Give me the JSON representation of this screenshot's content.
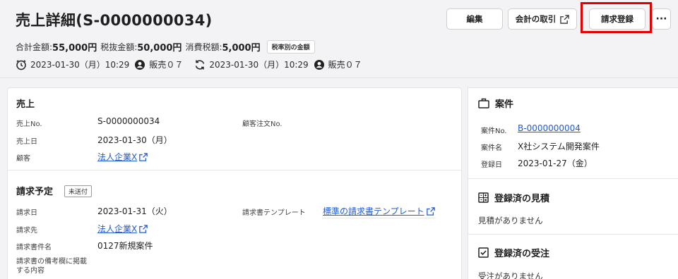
{
  "header": {
    "title": "売上詳細(S-0000000034)",
    "buttons": {
      "edit": "編集",
      "journal": "会計の取引",
      "invoice": "請求登録",
      "more": "···"
    }
  },
  "amounts": {
    "total_label": "合計金額:",
    "total_value": "55,000円",
    "pretax_label": "税抜金額:",
    "pretax_value": "50,000円",
    "tax_label": "消費税額:",
    "tax_value": "5,000円",
    "tax_badge": "税率別の金額"
  },
  "meta": {
    "created_at": "2023-01-30（月）10:29",
    "created_by": "販売０７",
    "updated_at": "2023-01-30（月）10:29",
    "updated_by": "販売０７"
  },
  "sales": {
    "section_title": "売上",
    "no_label": "売上No.",
    "no_value": "S-0000000034",
    "customer_order_label": "顧客注文No.",
    "date_label": "売上日",
    "date_value": "2023-01-30（月）",
    "customer_label": "顧客",
    "customer_value": "法人企業X"
  },
  "billing": {
    "section_title": "請求予定",
    "status": "未送付",
    "date_label": "請求日",
    "date_value": "2023-01-31（火）",
    "template_label": "請求書テンプレート",
    "template_value": "標準の請求書テンプレート",
    "to_label": "請求先",
    "to_value": "法人企業X",
    "subject_label": "請求書件名",
    "subject_value": "0127新規案件",
    "remarks_label_1": "請求書の備考欄に掲載",
    "remarks_label_2": "する内容"
  },
  "side": {
    "project": {
      "title": "案件",
      "no_label": "案件No.",
      "no_value": "B-0000000004",
      "name_label": "案件名",
      "name_value": "X社システム開発案件",
      "date_label": "登録日",
      "date_value": "2023-01-27（金）"
    },
    "quotes": {
      "title": "登録済の見積",
      "empty": "見積がありません"
    },
    "orders": {
      "title": "登録済の受注",
      "empty": "受注がありません"
    }
  },
  "colors": {
    "link": "#1f5bd6",
    "highlight": "#e30000",
    "background": "#f3f3f5"
  },
  "icons": [
    "clock-icon",
    "user-icon",
    "refresh-icon",
    "external-link-icon",
    "briefcase-icon",
    "calculator-icon",
    "check-square-icon"
  ]
}
